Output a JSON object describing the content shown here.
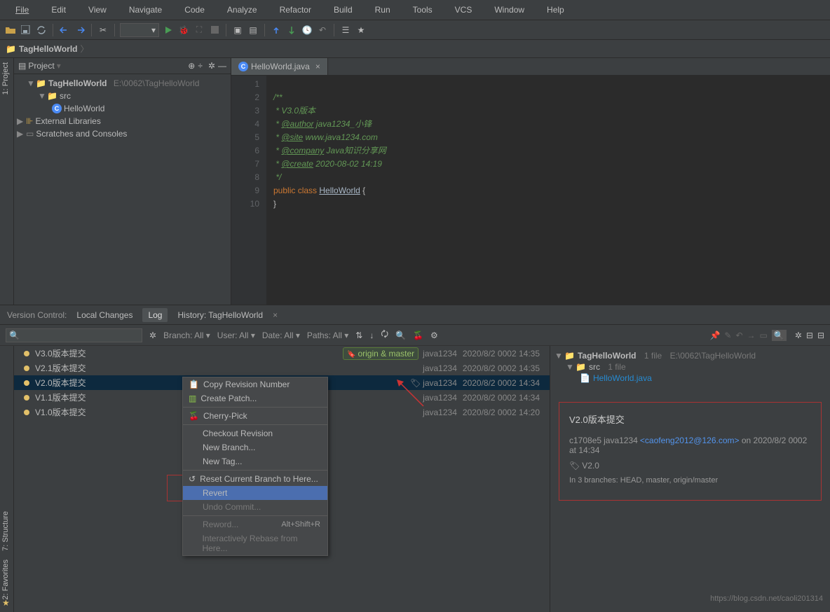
{
  "menu": {
    "items": [
      "File",
      "Edit",
      "View",
      "Navigate",
      "Code",
      "Analyze",
      "Refactor",
      "Build",
      "Run",
      "Tools",
      "VCS",
      "Window",
      "Help"
    ]
  },
  "breadcrumb": {
    "root": "TagHelloWorld"
  },
  "project_panel": {
    "title": "Project",
    "root": {
      "name": "TagHelloWorld",
      "path": "E:\\0062\\TagHelloWorld"
    },
    "src": "src",
    "classfile": "HelloWorld",
    "ext_lib": "External Libraries",
    "scratches": "Scratches and Consoles"
  },
  "editor": {
    "tab": "HelloWorld.java",
    "lines": [
      "1",
      "2",
      "3",
      "4",
      "5",
      "6",
      "7",
      "8",
      "9",
      "10"
    ],
    "code": {
      "l1": "/**",
      "l2": " * V3.0版本",
      "l3_pre": " * ",
      "l3_tag": "@author",
      "l3_post": " java1234_小锋",
      "l4_pre": " * ",
      "l4_tag": "@site",
      "l4_post": " www.java1234.com",
      "l5_pre": " * ",
      "l5_tag": "@company",
      "l5_post": " Java知识分享网",
      "l6_pre": " * ",
      "l6_tag": "@create",
      "l6_post": " 2020-08-02 14:19",
      "l7": " */",
      "l8_kw1": "public ",
      "l8_kw2": "class ",
      "l8_cls": "HelloWorld",
      "l8_end": " {",
      "l9": "}"
    }
  },
  "vc": {
    "title": "Version Control:",
    "tabs": {
      "local": "Local Changes",
      "log": "Log",
      "history": "History: TagHelloWorld"
    },
    "filters": {
      "branch": "Branch: All",
      "user": "User: All",
      "date": "Date: All",
      "paths": "Paths: All"
    },
    "commits": [
      {
        "msg": "V3.0版本提交",
        "author": "java1234",
        "date": "2020/8/2 0002 14:35",
        "badge": "origin & master"
      },
      {
        "msg": "V2.1版本提交",
        "author": "java1234",
        "date": "2020/8/2 0002 14:35"
      },
      {
        "msg": "V2.0版本提交",
        "author": "java1234",
        "date": "2020/8/2 0002 14:34",
        "tagged": true,
        "selected": true
      },
      {
        "msg": "V1.1版本提交",
        "author": "java1234",
        "date": "2020/8/2 0002 14:34"
      },
      {
        "msg": "V1.0版本提交",
        "author": "java1234",
        "date": "2020/8/2 0002 14:20"
      }
    ],
    "right": {
      "header": {
        "proj": "TagHelloWorld",
        "fcount": "1 file",
        "path": "E:\\0062\\TagHelloWorld"
      },
      "src": {
        "name": "src",
        "fcount": "1 file"
      },
      "file": "HelloWorld.java"
    },
    "detail": {
      "title": "V2.0版本提交",
      "hash": "c1708e5",
      "author": "java1234",
      "email": "<caofeng2012@126.com>",
      "on": " on 2020/8/2 0002 at 14:34",
      "tag": "V2.0",
      "branches": "In 3 branches: HEAD, master, origin/master"
    }
  },
  "context_menu": {
    "items": [
      {
        "label": "Copy Revision Number",
        "icon": "copy"
      },
      {
        "label": "Create Patch...",
        "icon": "patch"
      },
      {
        "label": "Cherry-Pick",
        "icon": "cherry"
      },
      {
        "label": "Checkout Revision"
      },
      {
        "label": "New Branch..."
      },
      {
        "label": "New Tag..."
      },
      {
        "label": "Reset Current Branch to Here...",
        "icon": "reset"
      },
      {
        "label": "Revert",
        "highlighted": true
      },
      {
        "label": "Undo Commit...",
        "dim": true
      },
      {
        "label": "Reword...",
        "hint": "Alt+Shift+R",
        "dim": true
      },
      {
        "label": "Interactively Rebase from Here...",
        "dim": true
      }
    ]
  },
  "side_tabs": {
    "project": "1: Project",
    "structure": "7: Structure",
    "favorites": "2: Favorites"
  },
  "watermark": "https://blog.csdn.net/caoli201314"
}
